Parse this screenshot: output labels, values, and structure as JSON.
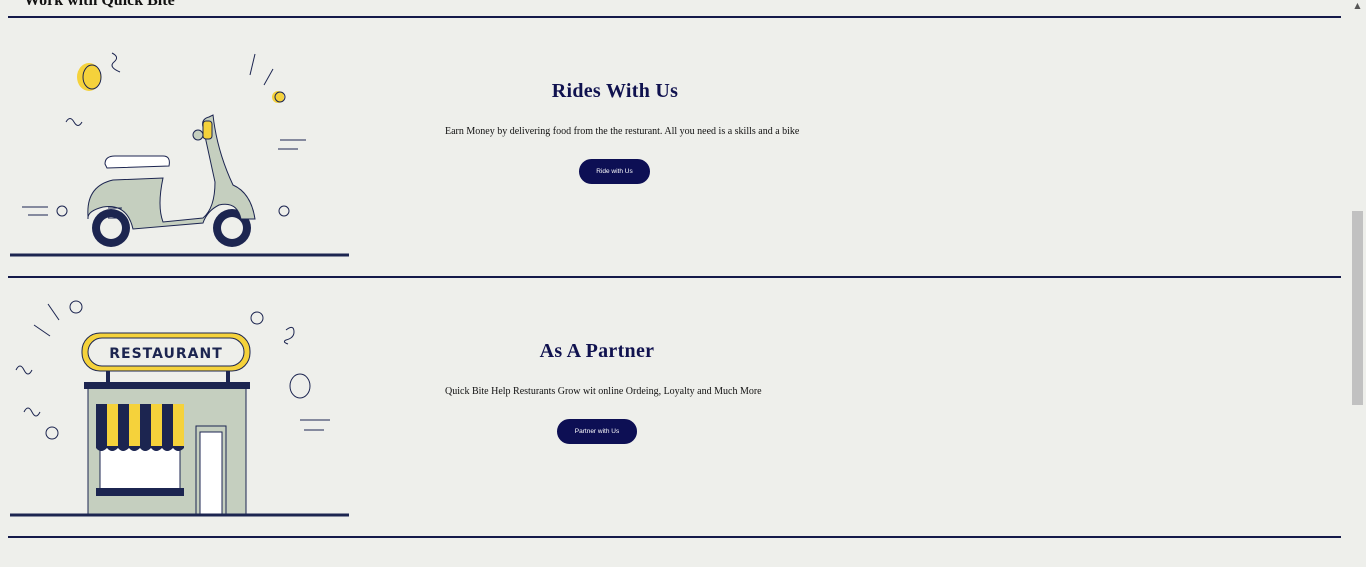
{
  "section": {
    "heading": "Work with Quick Bite"
  },
  "cards": [
    {
      "title": "Rides With Us",
      "description": "Earn Money by delivering food from the the resturant. All you need is a skills and a bike",
      "button_label": "Ride with Us",
      "illustration": "scooter-illustration"
    },
    {
      "title": "As A Partner",
      "description": "Quick Bite Help Resturants Grow wit online Ordeing, Loyalty and Much More",
      "button_label": "Partner with Us",
      "illustration": "restaurant-illustration",
      "sign_text": "RESTAURANT"
    }
  ],
  "colors": {
    "navy": "#141a4a",
    "button": "#0d0f54",
    "yellow": "#f5d23b",
    "sage": "#c5cfbf",
    "background": "#eeefeb"
  }
}
